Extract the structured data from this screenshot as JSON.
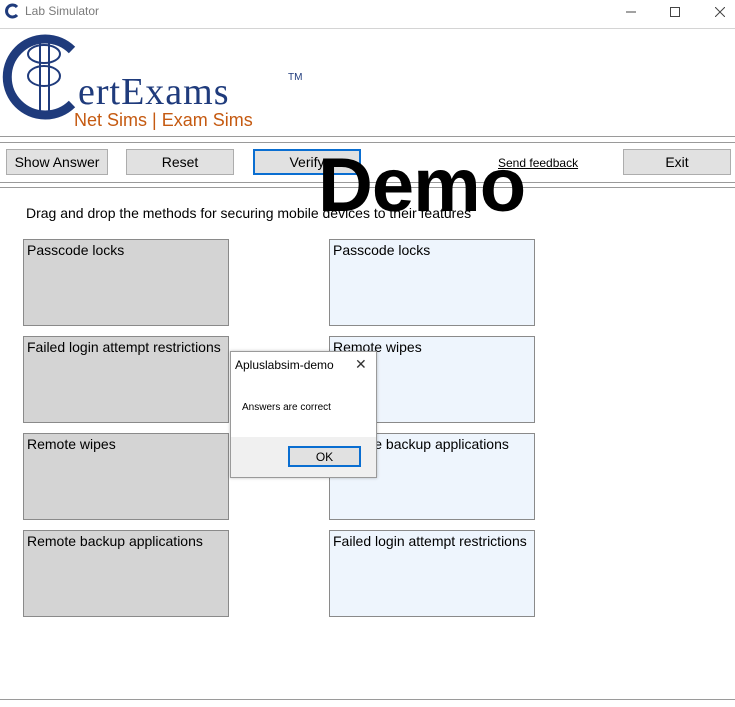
{
  "window": {
    "title": "Lab Simulator",
    "min_icon": "—",
    "max_icon": "☐",
    "close_icon": "✕"
  },
  "logo": {
    "brand": "ertExams",
    "tm": "TM",
    "tagline": "Net Sims | Exam Sims",
    "colors": {
      "blue": "#1f3b7c",
      "orange": "#c55a11"
    }
  },
  "toolbar": {
    "show_answer": "Show Answer",
    "reset": "Reset",
    "verify": "Verify",
    "send_feedback": "Send feedback",
    "exit": "Exit"
  },
  "watermark": "Demo",
  "instruction": "Drag and drop the methods for securing mobile devices to their features",
  "sources": [
    "Passcode locks",
    "Failed login attempt restrictions",
    "Remote wipes",
    "Remote backup applications"
  ],
  "targets": [
    "Passcode locks",
    "Remote wipes",
    "Remote backup applications",
    "Failed login attempt restrictions"
  ],
  "dialog": {
    "title": "Apluslabsim-demo",
    "message": "Answers are correct",
    "ok": "OK",
    "close_icon": "✕"
  },
  "colors": {
    "source_bg": "#d4d4d4",
    "target_bg": "#eef5fd",
    "accent": "#0a6ed1"
  }
}
